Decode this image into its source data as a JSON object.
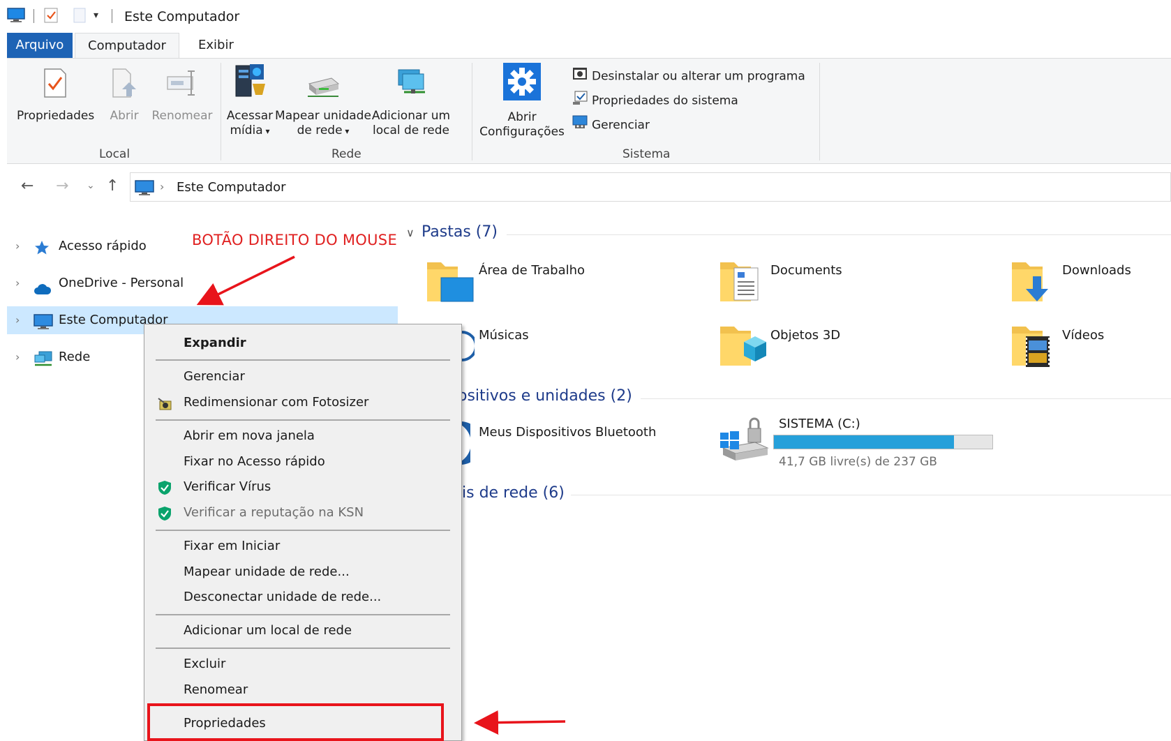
{
  "window": {
    "title": "Este Computador"
  },
  "tabs": {
    "file": "Arquivo",
    "computer": "Computador",
    "view": "Exibir"
  },
  "ribbon": {
    "local": {
      "label": "Local",
      "properties": "Propriedades",
      "open": "Abrir",
      "rename": "Renomear"
    },
    "network": {
      "label": "Rede",
      "media_line1": "Acessar",
      "media_line2": "mídia",
      "map_line1": "Mapear unidade",
      "map_line2": "de rede",
      "add_line1": "Adicionar um",
      "add_line2": "local de rede"
    },
    "system": {
      "label": "Sistema",
      "settings_line1": "Abrir",
      "settings_line2": "Configurações",
      "uninstall": "Desinstalar ou alterar um programa",
      "sysprops": "Propriedades do sistema",
      "manage": "Gerenciar"
    }
  },
  "address": {
    "path": "Este Computador"
  },
  "nav": {
    "items": [
      {
        "label": "Acesso rápido",
        "icon": "star-icon"
      },
      {
        "label": "OneDrive - Personal",
        "icon": "cloud-icon"
      },
      {
        "label": "Este Computador",
        "icon": "computer-icon"
      },
      {
        "label": "Rede",
        "icon": "network-icon"
      }
    ]
  },
  "content": {
    "folders_title": "Pastas (7)",
    "folders": [
      "Área de Trabalho",
      "Documents",
      "Downloads",
      "Músicas",
      "Objetos 3D",
      "Vídeos"
    ],
    "devices_title": "ositivos e unidades (2)",
    "bluetooth": "Meus Dispositivos Bluetooth",
    "drive": {
      "name": "SISTEMA (C:)",
      "free": "41,7 GB livre(s) de 237 GB",
      "used_fraction": 0.824
    },
    "network_title": "is de rede (6)"
  },
  "context_menu": {
    "expand": "Expandir",
    "manage": "Gerenciar",
    "fotosizer": "Redimensionar com Fotosizer",
    "new_window": "Abrir em nova janela",
    "pin_quick": "Fixar no Acesso rápido",
    "scan": "Verificar Vírus",
    "ksn": "Verificar a reputação na KSN",
    "pin_start": "Fixar em Iniciar",
    "map_drive": "Mapear unidade de rede...",
    "disconnect": "Desconectar unidade de rede...",
    "add_location": "Adicionar um local de rede",
    "delete": "Excluir",
    "rename": "Renomear",
    "properties": "Propriedades"
  },
  "annotation": {
    "label": "BOTÃO DIREITO DO MOUSE",
    "color": "#e8141b"
  },
  "colors": {
    "accent": "#1e63b5",
    "selection": "#cce8ff",
    "section": "#1e3b8a"
  }
}
